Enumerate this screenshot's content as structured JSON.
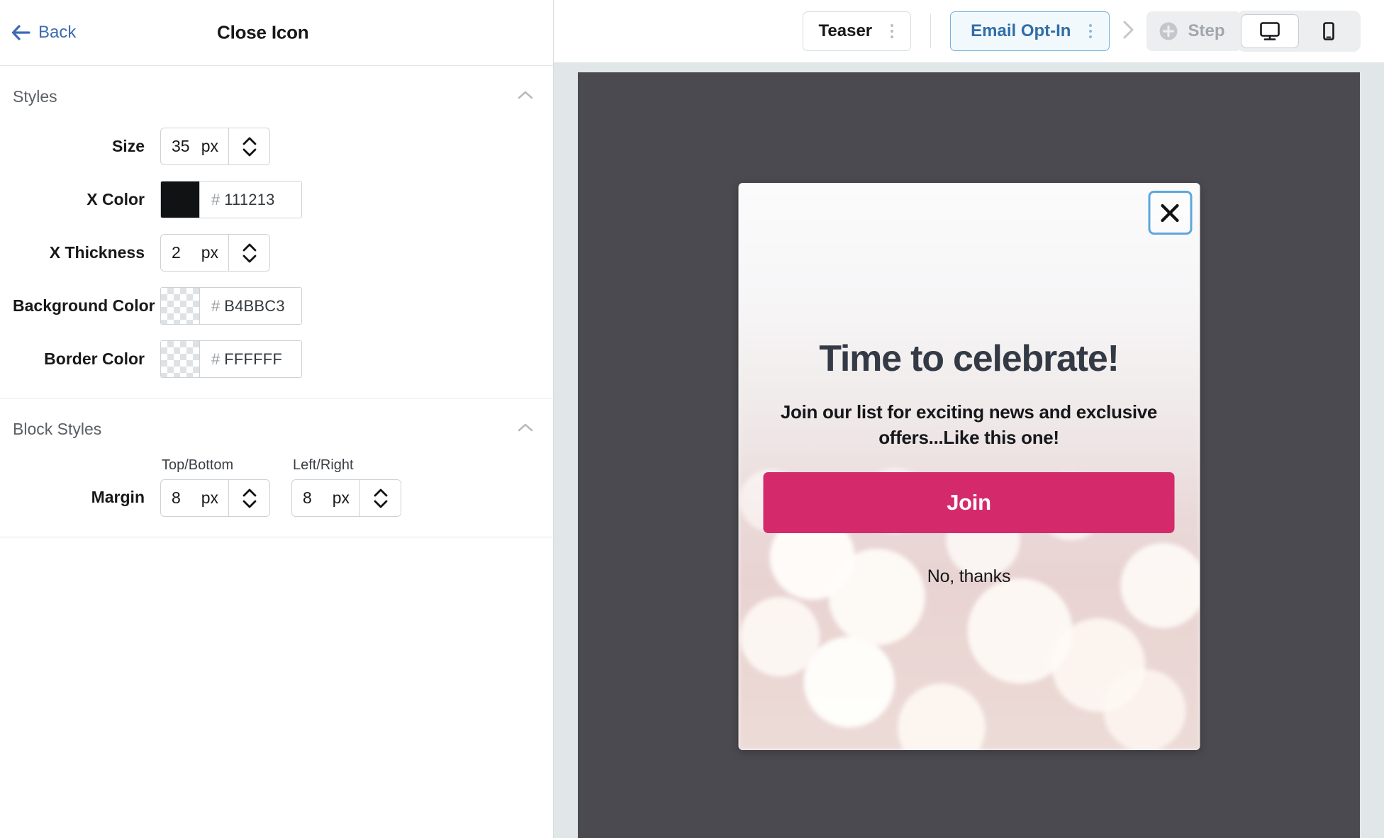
{
  "left_panel": {
    "back_label": "Back",
    "title": "Close Icon",
    "sections": [
      {
        "title": "Styles",
        "collapse_icon": "chevron-up-icon",
        "fields": [
          {
            "label": "Size",
            "type": "number",
            "value": "35",
            "unit": "px"
          },
          {
            "label": "X Color",
            "type": "color",
            "hash": "#",
            "value": "111213",
            "swatch": "#111213",
            "transparent": false
          },
          {
            "label": "X Thickness",
            "type": "number",
            "value": "2",
            "unit": "px"
          },
          {
            "label": "Background Color",
            "type": "color",
            "hash": "#",
            "value": "B4BBC3",
            "swatch": "",
            "transparent": true
          },
          {
            "label": "Border Color",
            "type": "color",
            "hash": "#",
            "value": "FFFFFF",
            "swatch": "",
            "transparent": true
          }
        ]
      },
      {
        "title": "Block Styles",
        "collapse_icon": "chevron-up-icon",
        "margin": {
          "label": "Margin",
          "top_bottom": {
            "caption": "Top/Bottom",
            "value": "8",
            "unit": "px"
          },
          "left_right": {
            "caption": "Left/Right",
            "value": "8",
            "unit": "px"
          }
        }
      }
    ]
  },
  "toolbar": {
    "teaser_tab": "Teaser",
    "active_tab": "Email Opt-In",
    "step_button": "Step",
    "devices": {
      "desktop": "desktop-monitor-icon",
      "mobile": "mobile-phone-icon",
      "selected": "desktop"
    }
  },
  "preview": {
    "heading": "Time to celebrate!",
    "subheading": "Join our list for exciting news and exclusive offers...Like this one!",
    "primary_button": "Join",
    "decline_link": "No, thanks",
    "close_icon": "close-x-icon"
  },
  "colors": {
    "accent_blue": "#2f6ea8",
    "selection_blue": "#5da7dd",
    "join_pink": "#d42a6b",
    "canvas_dark": "#4a4a50",
    "heading_dark": "#343a45"
  }
}
